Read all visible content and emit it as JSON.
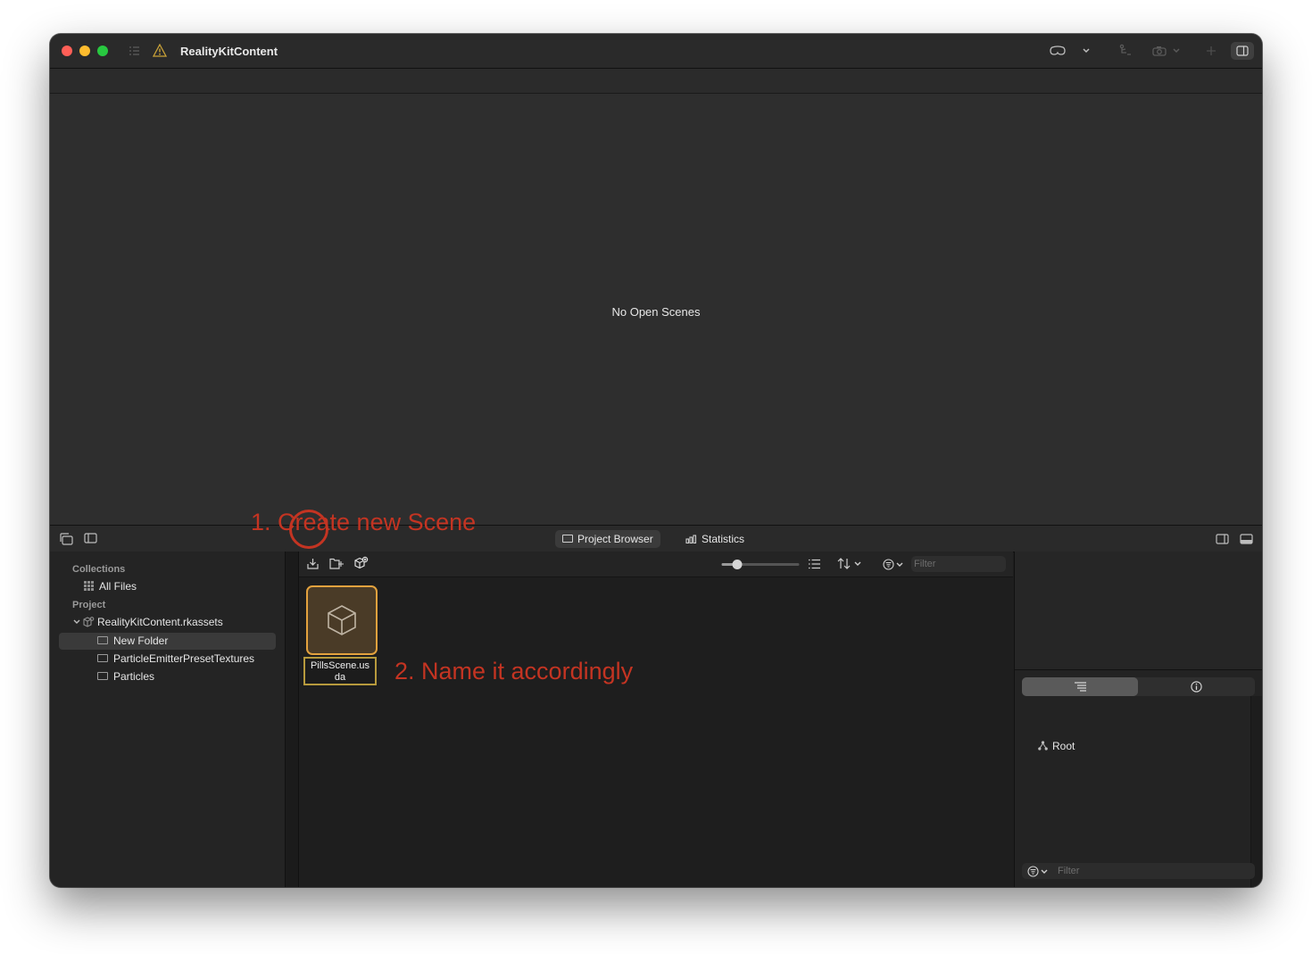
{
  "window": {
    "title": "RealityKitContent"
  },
  "viewport": {
    "message": "No Open Scenes"
  },
  "tabs": [
    {
      "label": "Project Browser",
      "icon": "folder-icon",
      "active": true
    },
    {
      "label": "Statistics",
      "icon": "bar-chart-icon",
      "active": false
    }
  ],
  "sidebar": {
    "collections_header": "Collections",
    "all_files": "All Files",
    "project_header": "Project",
    "package": "RealityKitContent.rkassets",
    "folders": [
      "New Folder",
      "ParticleEmitterPresetTextures",
      "Particles"
    ],
    "selected": "New Folder"
  },
  "browser": {
    "filter_placeholder": "Filter",
    "thumbnail_size_percent": 20,
    "new_item_name_line1": "PillsScene.us",
    "new_item_name_line2": "da"
  },
  "annotations": {
    "step1": "1. Create new Scene",
    "step2": "2. Name it accordingly",
    "color": "#c43422"
  },
  "inspector": {
    "root_label": "Root",
    "filter_placeholder": "Filter"
  },
  "colors": {
    "selection_border": "#e3a23e",
    "tile_fill": "#4a3b27"
  }
}
